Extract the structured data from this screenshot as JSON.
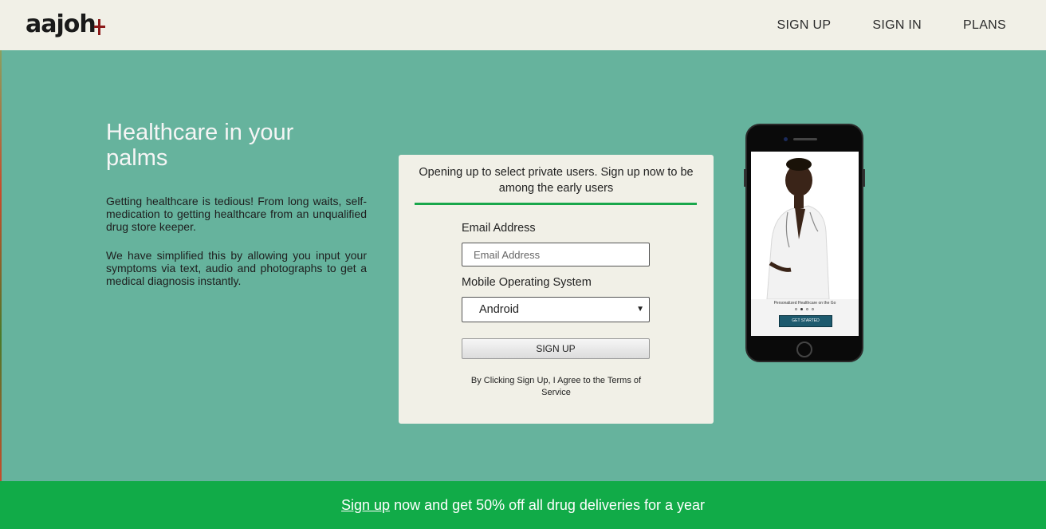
{
  "brand": {
    "logo_text": "aajoh"
  },
  "nav": {
    "signup": "SIGN UP",
    "signin": "SIGN IN",
    "plans": "PLANS"
  },
  "hero": {
    "title": "Healthcare in your palms",
    "p1": "Getting healthcare is tedious! From long waits, self-medication to getting healthcare from an unqualified drug store keeper.",
    "p2": "We have simplified this by allowing you input your symptoms via text, audio and photographs to get a medical diagnosis instantly."
  },
  "form": {
    "heading": "Opening up to select private users. Sign up now to be among the early users",
    "email_label": "Email Address",
    "email_placeholder": "Email Address",
    "os_label": "Mobile Operating System",
    "os_selected": "Android",
    "submit": "SIGN UP",
    "terms": "By Clicking Sign Up, I Agree to the Terms of Service"
  },
  "phone": {
    "caption": "Personalized Healthcare on the Go",
    "cta": "GET STARTED"
  },
  "footer": {
    "link": "Sign up",
    "text": " now and get 50% off all drug deliveries for a year"
  },
  "colors": {
    "background": "#66b39d",
    "header": "#f1f0e7",
    "accent_green": "#11ab48",
    "logo_plus": "#8b1a1a"
  }
}
